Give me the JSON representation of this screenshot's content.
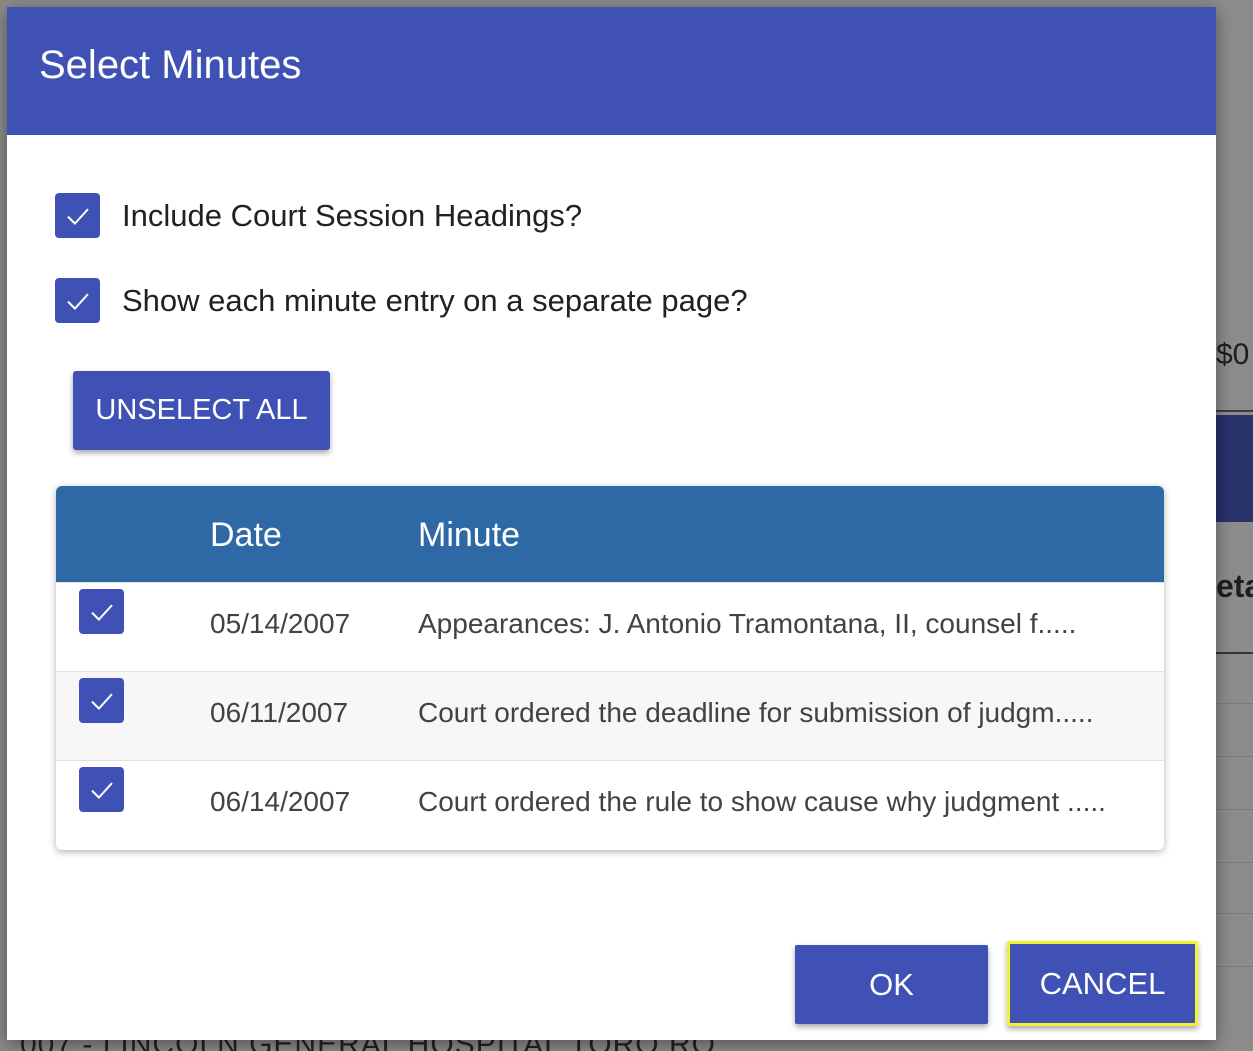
{
  "background": {
    "amount_fragment": "$0",
    "heading_fragment": "eta",
    "bottom_fragment": "007 - LINCOLN GENERAL HOSPITAL TORO RO"
  },
  "dialog": {
    "title": "Select Minutes",
    "options": [
      {
        "label": "Include Court Session Headings?",
        "checked": true
      },
      {
        "label": "Show each minute entry on a separate page?",
        "checked": true
      }
    ],
    "unselect_all_label": "UNSELECT ALL",
    "table": {
      "headers": {
        "date": "Date",
        "minute": "Minute"
      },
      "rows": [
        {
          "checked": true,
          "date": "05/14/2007",
          "minute": "Appearances: J. Antonio Tramontana, II, counsel f....."
        },
        {
          "checked": true,
          "date": "06/11/2007",
          "minute": "Court ordered the deadline for submission of judgm....."
        },
        {
          "checked": true,
          "date": "06/14/2007",
          "minute": "Court ordered the rule to show cause why judgment ....."
        }
      ]
    },
    "ok_label": "OK",
    "cancel_label": "CANCEL"
  },
  "colors": {
    "primary": "#3f51b5",
    "table_header": "#2f69a5",
    "focus_outline": "#f2f22e"
  },
  "icons": {
    "checkbox_mark": "checkmark-icon"
  }
}
